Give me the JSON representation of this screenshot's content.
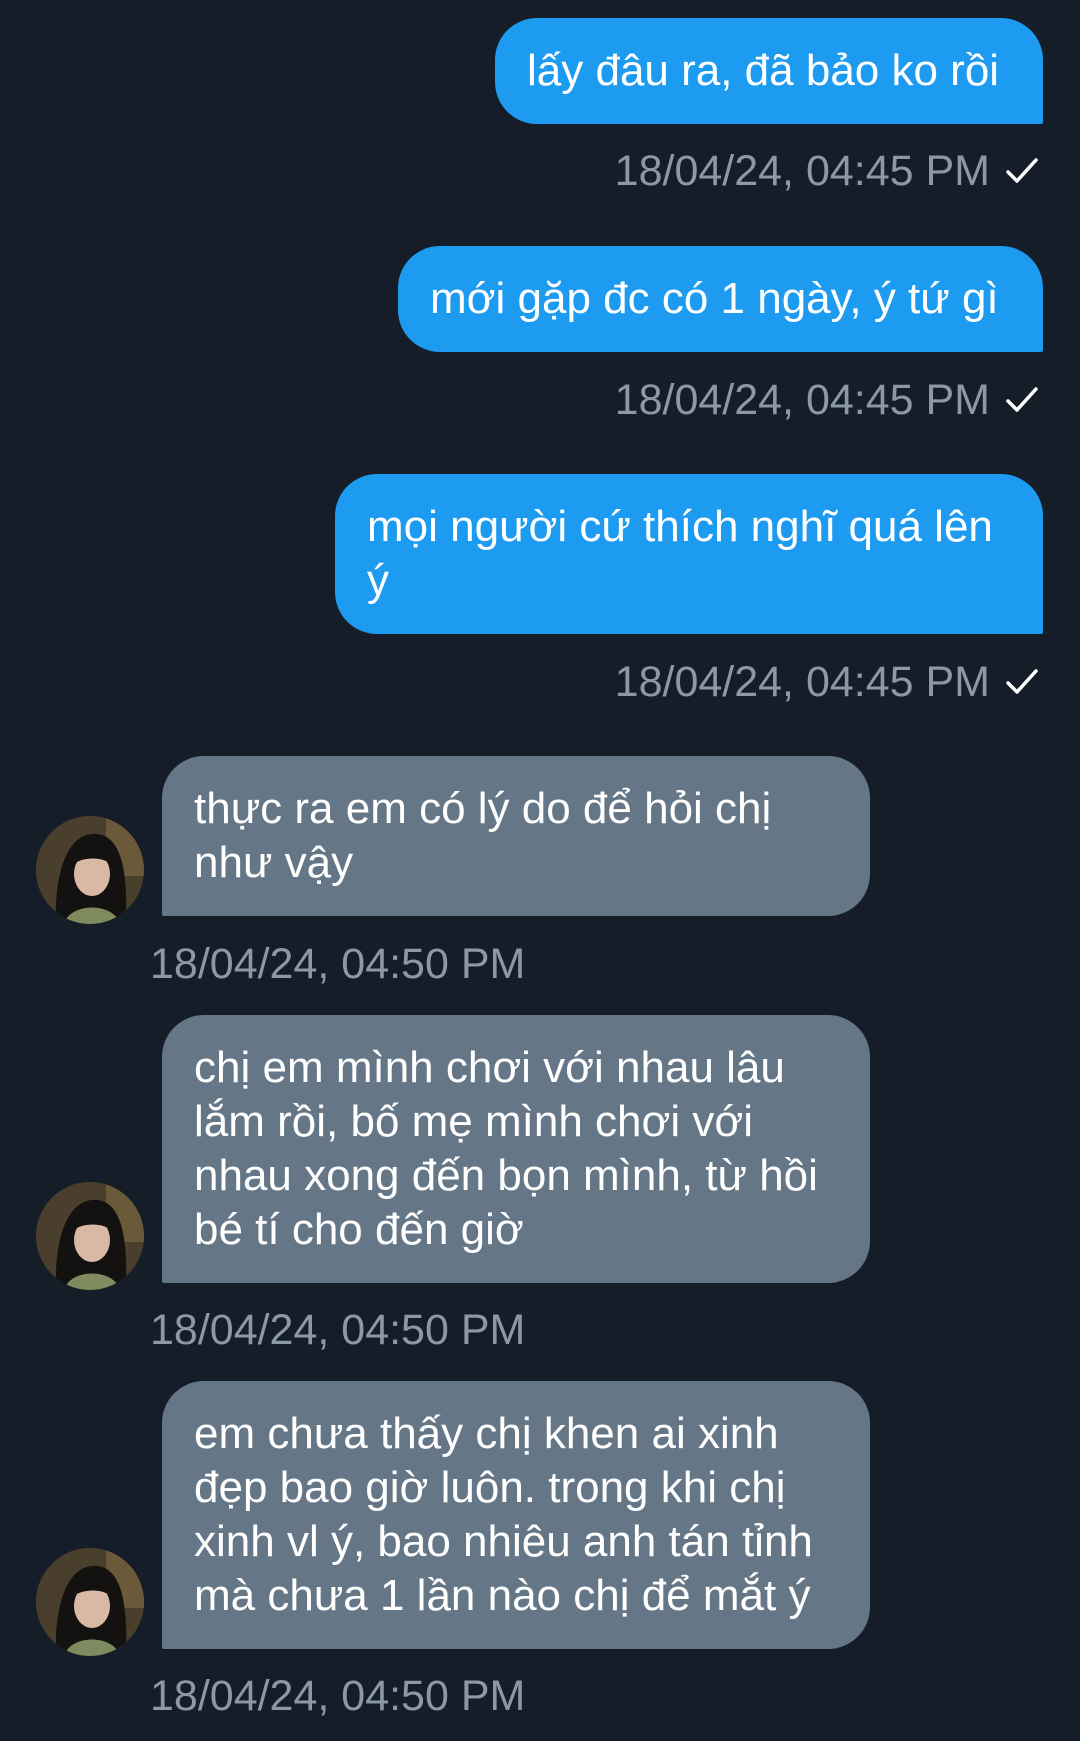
{
  "colors": {
    "background": "#151d28",
    "outgoing_bubble": "#1d9bf0",
    "incoming_bubble": "#657786",
    "timestamp": "#8b98a5"
  },
  "messages": [
    {
      "direction": "outgoing",
      "text": "lấy đâu ra, đã bảo ko rồi",
      "time": "18/04/24, 04:45 PM",
      "status_icon": "check-icon"
    },
    {
      "direction": "outgoing",
      "text": "mới gặp đc có 1 ngày, ý tứ gì",
      "time": "18/04/24, 04:45 PM",
      "status_icon": "check-icon"
    },
    {
      "direction": "outgoing",
      "text": "mọi người cứ thích nghĩ quá lên ý",
      "time": "18/04/24, 04:45 PM",
      "status_icon": "check-icon"
    },
    {
      "direction": "incoming",
      "text": "thực ra em có lý do để hỏi chị như vậy",
      "time": "18/04/24, 04:50 PM",
      "avatar_icon": "avatar"
    },
    {
      "direction": "incoming",
      "text": "chị em mình chơi với nhau lâu lắm rồi, bố mẹ mình chơi với nhau xong đến bọn mình, từ hồi bé tí cho đến giờ",
      "time": "18/04/24, 04:50 PM",
      "avatar_icon": "avatar"
    },
    {
      "direction": "incoming",
      "text": "em chưa thấy chị khen ai xinh đẹp bao giờ luôn. trong khi chị xinh vl ý, bao nhiêu anh tán tỉnh mà chưa 1 lần nào chị để mắt ý",
      "time": "18/04/24, 04:50 PM",
      "avatar_icon": "avatar"
    }
  ]
}
